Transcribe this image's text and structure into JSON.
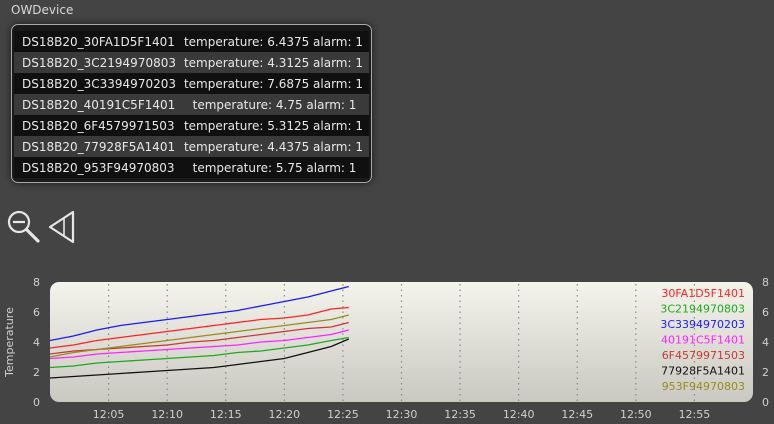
{
  "section_title": "OWDevice",
  "devices": [
    {
      "name": "DS18B20_30FA1D5F1401",
      "state": "temperature: 6.4375 alarm: 1"
    },
    {
      "name": "DS18B20_3C2194970803",
      "state": "temperature: 4.3125 alarm: 1"
    },
    {
      "name": "DS18B20_3C3394970203",
      "state": "temperature: 7.6875 alarm: 1"
    },
    {
      "name": "DS18B20_40191C5F1401",
      "state": "temperature: 4.75 alarm: 1"
    },
    {
      "name": "DS18B20_6F4579971503",
      "state": "temperature: 5.3125 alarm: 1"
    },
    {
      "name": "DS18B20_77928F5A1401",
      "state": "temperature: 4.4375 alarm: 1"
    },
    {
      "name": "DS18B20_953F94970803",
      "state": "temperature: 5.75 alarm: 1"
    }
  ],
  "toolbar": {
    "zoom_out_icon": "zoom-out-icon",
    "back_icon": "back-triangle-icon"
  },
  "chart_data": {
    "type": "line",
    "xlabel": "",
    "ylabel": "Temperature",
    "ylim": [
      0,
      8
    ],
    "yticks": [
      "0",
      "2",
      "4",
      "6",
      "8"
    ],
    "y2ticks": [
      "0",
      "2",
      "4",
      "6",
      "8"
    ],
    "xlim_minutes": [
      0,
      60
    ],
    "xticks": [
      "12:05",
      "12:10",
      "12:15",
      "12:20",
      "12:25",
      "12:30",
      "12:35",
      "12:40",
      "12:45",
      "12:50",
      "12:55"
    ],
    "legend_position": "top-right",
    "grid": "vertical-dotted",
    "series": [
      {
        "name": "30FA1D5F1401",
        "color": "#ff2222",
        "points": [
          [
            0,
            3.6
          ],
          [
            2,
            3.8
          ],
          [
            4,
            4.1
          ],
          [
            6,
            4.3
          ],
          [
            8,
            4.5
          ],
          [
            10,
            4.7
          ],
          [
            12,
            4.9
          ],
          [
            14,
            5.1
          ],
          [
            16,
            5.3
          ],
          [
            18,
            5.5
          ],
          [
            20,
            5.6
          ],
          [
            22,
            5.8
          ],
          [
            24,
            6.2
          ],
          [
            25.5,
            6.3
          ]
        ]
      },
      {
        "name": "3C2194970803",
        "color": "#1fa81f",
        "points": [
          [
            0,
            2.3
          ],
          [
            2,
            2.4
          ],
          [
            4,
            2.6
          ],
          [
            6,
            2.7
          ],
          [
            8,
            2.8
          ],
          [
            10,
            2.9
          ],
          [
            12,
            3.0
          ],
          [
            14,
            3.1
          ],
          [
            16,
            3.3
          ],
          [
            18,
            3.4
          ],
          [
            20,
            3.6
          ],
          [
            22,
            3.8
          ],
          [
            24,
            4.1
          ],
          [
            25.5,
            4.3
          ]
        ]
      },
      {
        "name": "3C3394970203",
        "color": "#1a1aff",
        "points": [
          [
            0,
            4.1
          ],
          [
            2,
            4.4
          ],
          [
            4,
            4.8
          ],
          [
            6,
            5.1
          ],
          [
            8,
            5.3
          ],
          [
            10,
            5.5
          ],
          [
            12,
            5.7
          ],
          [
            14,
            5.9
          ],
          [
            16,
            6.1
          ],
          [
            18,
            6.4
          ],
          [
            20,
            6.7
          ],
          [
            22,
            7.0
          ],
          [
            24,
            7.4
          ],
          [
            25.5,
            7.7
          ]
        ]
      },
      {
        "name": "40191C5F1401",
        "color": "#ff22ff",
        "points": [
          [
            0,
            2.9
          ],
          [
            2,
            3.0
          ],
          [
            4,
            3.2
          ],
          [
            6,
            3.3
          ],
          [
            8,
            3.4
          ],
          [
            10,
            3.5
          ],
          [
            12,
            3.6
          ],
          [
            14,
            3.7
          ],
          [
            16,
            3.8
          ],
          [
            18,
            4.0
          ],
          [
            20,
            4.1
          ],
          [
            22,
            4.3
          ],
          [
            24,
            4.5
          ],
          [
            25.5,
            4.8
          ]
        ]
      },
      {
        "name": "6F4579971503",
        "color": "#c83838",
        "points": [
          [
            0,
            3.2
          ],
          [
            2,
            3.4
          ],
          [
            4,
            3.5
          ],
          [
            6,
            3.6
          ],
          [
            8,
            3.7
          ],
          [
            10,
            3.8
          ],
          [
            12,
            4.0
          ],
          [
            14,
            4.1
          ],
          [
            16,
            4.3
          ],
          [
            18,
            4.5
          ],
          [
            20,
            4.7
          ],
          [
            22,
            4.9
          ],
          [
            24,
            5.0
          ],
          [
            25.5,
            5.3
          ]
        ]
      },
      {
        "name": "77928F5A1401",
        "color": "#111111",
        "points": [
          [
            0,
            1.6
          ],
          [
            2,
            1.7
          ],
          [
            4,
            1.8
          ],
          [
            6,
            1.9
          ],
          [
            8,
            2.0
          ],
          [
            10,
            2.1
          ],
          [
            12,
            2.2
          ],
          [
            14,
            2.3
          ],
          [
            16,
            2.5
          ],
          [
            18,
            2.7
          ],
          [
            20,
            2.9
          ],
          [
            22,
            3.3
          ],
          [
            24,
            3.7
          ],
          [
            25.5,
            4.2
          ]
        ]
      },
      {
        "name": "953F94970803",
        "color": "#9a8a20",
        "points": [
          [
            0,
            3.0
          ],
          [
            2,
            3.3
          ],
          [
            4,
            3.5
          ],
          [
            6,
            3.7
          ],
          [
            8,
            3.9
          ],
          [
            10,
            4.1
          ],
          [
            12,
            4.3
          ],
          [
            14,
            4.5
          ],
          [
            16,
            4.7
          ],
          [
            18,
            4.9
          ],
          [
            20,
            5.1
          ],
          [
            22,
            5.3
          ],
          [
            24,
            5.5
          ],
          [
            25.5,
            5.8
          ]
        ]
      }
    ]
  }
}
